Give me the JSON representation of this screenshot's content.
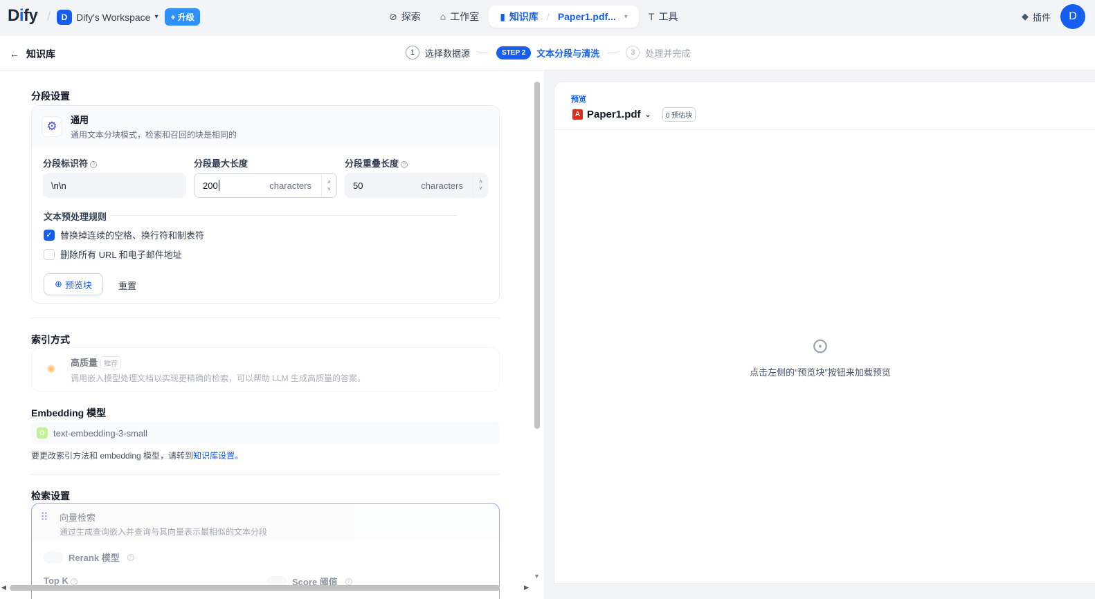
{
  "app": {
    "logo_prefix": "D",
    "logo_i": "i",
    "logo_suffix": "fy"
  },
  "workspace": {
    "avatar": "D",
    "name": "Dify's Workspace",
    "upgrade": "+ 升级"
  },
  "nav": {
    "explore": "探索",
    "studio": "工作室",
    "knowledge": "知识库",
    "doc": "Paper1.pdf...",
    "tools": "工具"
  },
  "top_right": {
    "plugins": "插件",
    "avatar": "D"
  },
  "subheader": {
    "back_label": "知识库",
    "step1_num": "1",
    "step1": "选择数据源",
    "step2_badge": "STEP 2",
    "step2": "文本分段与清洗",
    "step3_num": "3",
    "step3": "处理并完成"
  },
  "chunk": {
    "section_title": "分段设置",
    "mode_title": "通用",
    "mode_desc": "通用文本分块模式，检索和召回的块是相同的",
    "delimiter_label": "分段标识符",
    "delimiter_value": "\\n\\n",
    "max_len_label": "分段最大长度",
    "max_len_value": "200",
    "overlap_label": "分段重叠长度",
    "overlap_value": "50",
    "unit": "characters",
    "rules_title": "文本预处理规则",
    "rule1": "替换掉连续的空格、换行符和制表符",
    "rule1_checked": true,
    "rule2": "删除所有 URL 和电子邮件地址",
    "rule2_checked": false,
    "preview_btn": "预览块",
    "reset_btn": "重置"
  },
  "index": {
    "section_title": "索引方式",
    "hq_title": "高质量",
    "hq_tag": "推荐",
    "hq_desc": "调用嵌入模型处理文档以实现更精确的检索，可以帮助 LLM 生成高质量的答案。"
  },
  "embedding": {
    "section_title": "Embedding 模型",
    "model": "text-embedding-3-small",
    "note_prefix": "要更改索引方法和 embedding 模型，请转到",
    "note_link": "知识库设置。"
  },
  "retrieval": {
    "section_title": "检索设置",
    "vec_title": "向量检索",
    "vec_desc": "通过生成查询嵌入并查询与其向量表示最相似的文本分段",
    "rerank": "Rerank 模型",
    "topk": "Top K",
    "score": "Score 阈值"
  },
  "preview": {
    "label": "预览",
    "file": "Paper1.pdf",
    "count": "0 预估块",
    "empty_msg": "点击左侧的“预览块”按钮来加载预览"
  },
  "colors": {
    "accent": "#155eef",
    "upgrade": "#2e90fa",
    "pdf": "#d92d20"
  }
}
